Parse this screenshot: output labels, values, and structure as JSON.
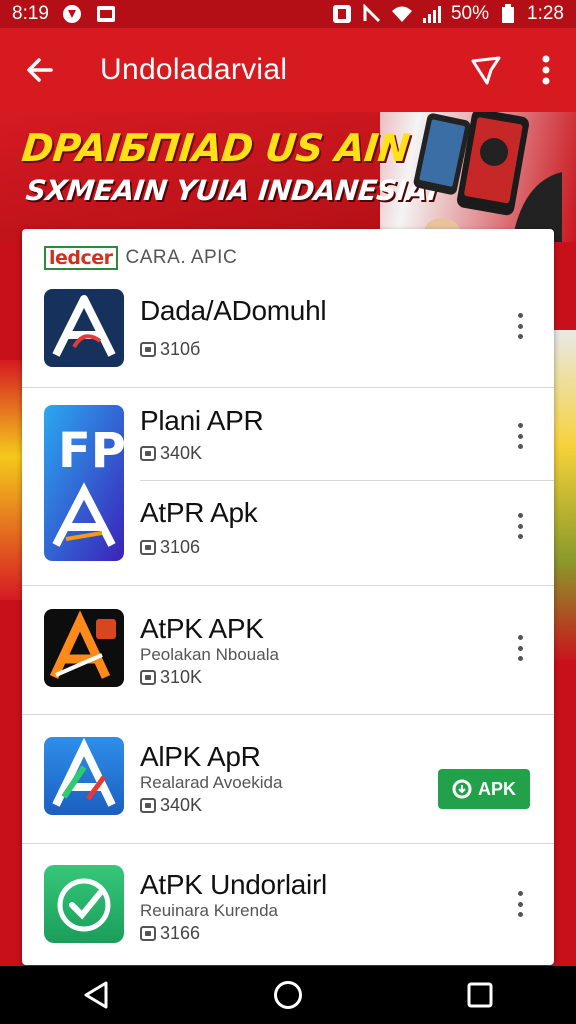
{
  "status_bar": {
    "time": "8:19",
    "battery": "50%",
    "clock": "1:28"
  },
  "app_bar": {
    "title": "Undoladarvial"
  },
  "banner": {
    "line1": "DPAIБПIAD US  AIN",
    "line2": "SXMEAIN YUIA INDANESIAI"
  },
  "list": {
    "header_logo": "ledcer",
    "header_label": "CARA. APIC",
    "items": [
      {
        "name": "Dada/ADomuhl",
        "sub": "",
        "size": "310б",
        "icon": "apk-a-icon"
      },
      {
        "name": "Plani APR",
        "sub": "",
        "size": "340K",
        "icon": "fp-icon"
      },
      {
        "name": "AtPR Apk",
        "sub": "",
        "size": "3106",
        "icon": "apk-a-icon"
      },
      {
        "name": "AtPK APK",
        "sub": "Peolakan Nbouala",
        "size": "310K",
        "icon": "apk-a-icon"
      },
      {
        "name": "AlPK ApR",
        "sub": "Realarad Avoekida",
        "size": "340K",
        "icon": "apk-a-icon",
        "action": "APK"
      },
      {
        "name": "AtPK Undorlairl",
        "sub": "Reuinara Kurenda",
        "size": "3166",
        "icon": "check-icon"
      }
    ]
  },
  "colors": {
    "primary": "#d71920",
    "apk_button": "#23a04a"
  }
}
